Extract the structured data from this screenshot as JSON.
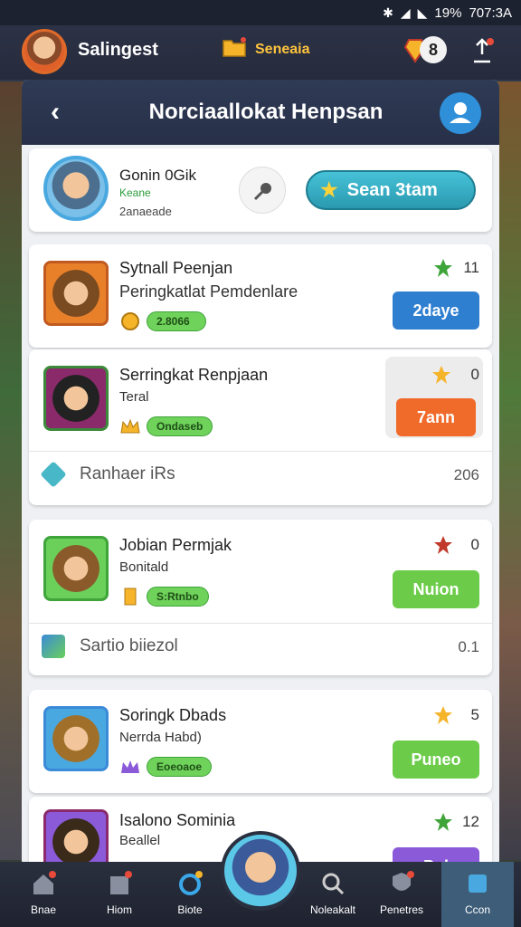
{
  "status_bar": {
    "battery": "19%",
    "time": "707:3A"
  },
  "app_bar": {
    "app_name": "Salingest",
    "folder_label": "Seneaia",
    "gem_count": "8"
  },
  "panel": {
    "title": "Norciaallokat Henpsan",
    "user_card": {
      "name": "Gonin 0Gik",
      "sub": "Keane",
      "extra": "2anaeade",
      "cta_label": "Sean 3tam"
    },
    "items": [
      {
        "title": "Sytnall Peenjan",
        "sub": "Peringkatlat Pemdenlare",
        "pill": "2.8066",
        "rank": "11",
        "action": "2daye",
        "action_color": "#2f7fd0"
      },
      {
        "title": "Serringkat Renpjaan",
        "sub": "Teral",
        "pill": "Ondaseb",
        "rank": "0",
        "action": "7ann",
        "action_color": "#f06a2a",
        "footer_label": "Ranhaer iRs",
        "footer_value": "206"
      },
      {
        "title": "Jobian Permjak",
        "sub": "Bonitald",
        "pill": "S:Rtnbo",
        "rank": "0",
        "action": "Nuion",
        "action_color": "#6ccc4a",
        "footer_label": "Sartio biiezol",
        "footer_value": "0.1"
      },
      {
        "title": "Soringk Dbads",
        "sub": "Nerrda Habd)",
        "pill": "Eoeoaoe",
        "rank": "5",
        "action": "Puneo",
        "action_color": "#6ccc4a"
      },
      {
        "title": "Isalono Sominia",
        "sub": "Beallel",
        "pill": "",
        "rank": "12",
        "action": "Pul",
        "action_color": "#8a5ad8"
      }
    ]
  },
  "bottom_nav": [
    {
      "label": "Bnae"
    },
    {
      "label": "Hiom"
    },
    {
      "label": "Biote"
    },
    {
      "label": "Noleakalt"
    },
    {
      "label": "Penetres"
    },
    {
      "label": "Ccon"
    }
  ],
  "colors": {
    "accent": "#2f8fd8",
    "header": "#2f3a55",
    "green": "#6fd25a"
  }
}
